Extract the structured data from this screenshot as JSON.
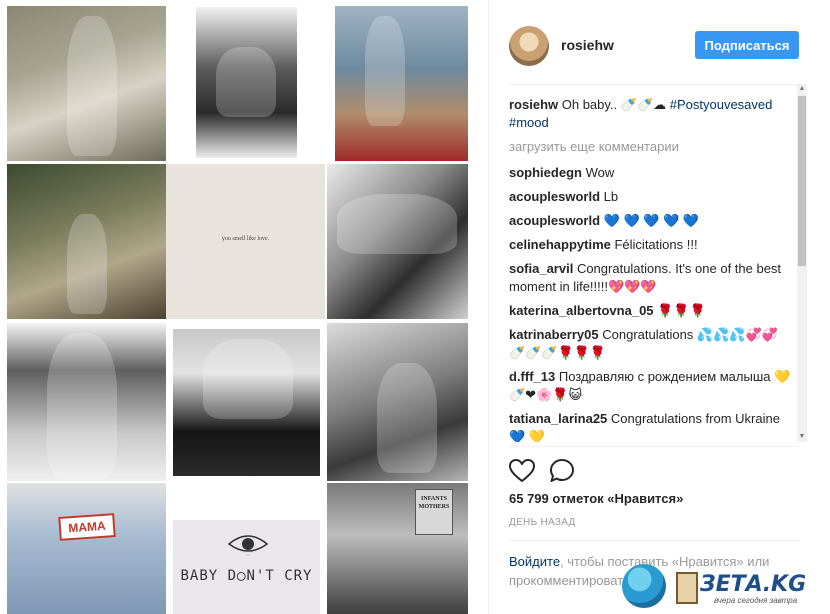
{
  "post": {
    "username": "rosiehw",
    "follow_label": "Подписаться",
    "caption_user": "rosiehw",
    "caption_text": " Oh baby.. 🍼🍼☁ ",
    "caption_hashtags": "#Postyouvesaved #mood",
    "load_more": "загрузить еще комментарии",
    "comments": [
      {
        "user": "sophiedegn",
        "text": " Wow"
      },
      {
        "user": "acouplesworld",
        "text": " Lb"
      },
      {
        "user": "acouplesworld",
        "text": " 💙 💙 💙 💙 💙"
      },
      {
        "user": "celinehappytime",
        "text": " Félicitations !!!"
      },
      {
        "user": "sofia_arvil",
        "text": " Congratulations. It's one of the best moment in life!!!!!💖💖💖"
      },
      {
        "user": "katerina_albertovna_05",
        "text": " 🌹🌹🌹"
      },
      {
        "user": "katrinaberry05",
        "text": " Congratulations 💦💦💦💞💞 🍼🍼🍼🌹🌹🌹"
      },
      {
        "user": "d.fff_13",
        "text": " Поздравляю с рождением малыша 💛🍼❤🌸🌹😺"
      },
      {
        "user": "tatiana_larina25",
        "text": " Congratulations from Ukraine 💙 💛"
      }
    ],
    "likes": "65 799 отметок «Нравится»",
    "date": "ДЕНЬ НАЗАД",
    "login_link": "Войдите",
    "login_text": ", чтобы поставить «Нравится» или прокомментировать."
  },
  "icons": [
    "heart-icon",
    "comment-icon"
  ],
  "grid": {
    "tile5_text": "you smell like love.",
    "tile10_patch": "MAMA",
    "tile11_text": "BABY D◯N'T CRY",
    "tile12_book_line1": "INFANTS",
    "tile12_book_line2": "MOTHERS"
  },
  "watermark": {
    "brand": "ЗЕТА.KG",
    "tagline": "вчера сегодня завтра"
  },
  "colors": {
    "accent": "#3897f0",
    "hashtag": "#003569",
    "muted": "#999999"
  }
}
